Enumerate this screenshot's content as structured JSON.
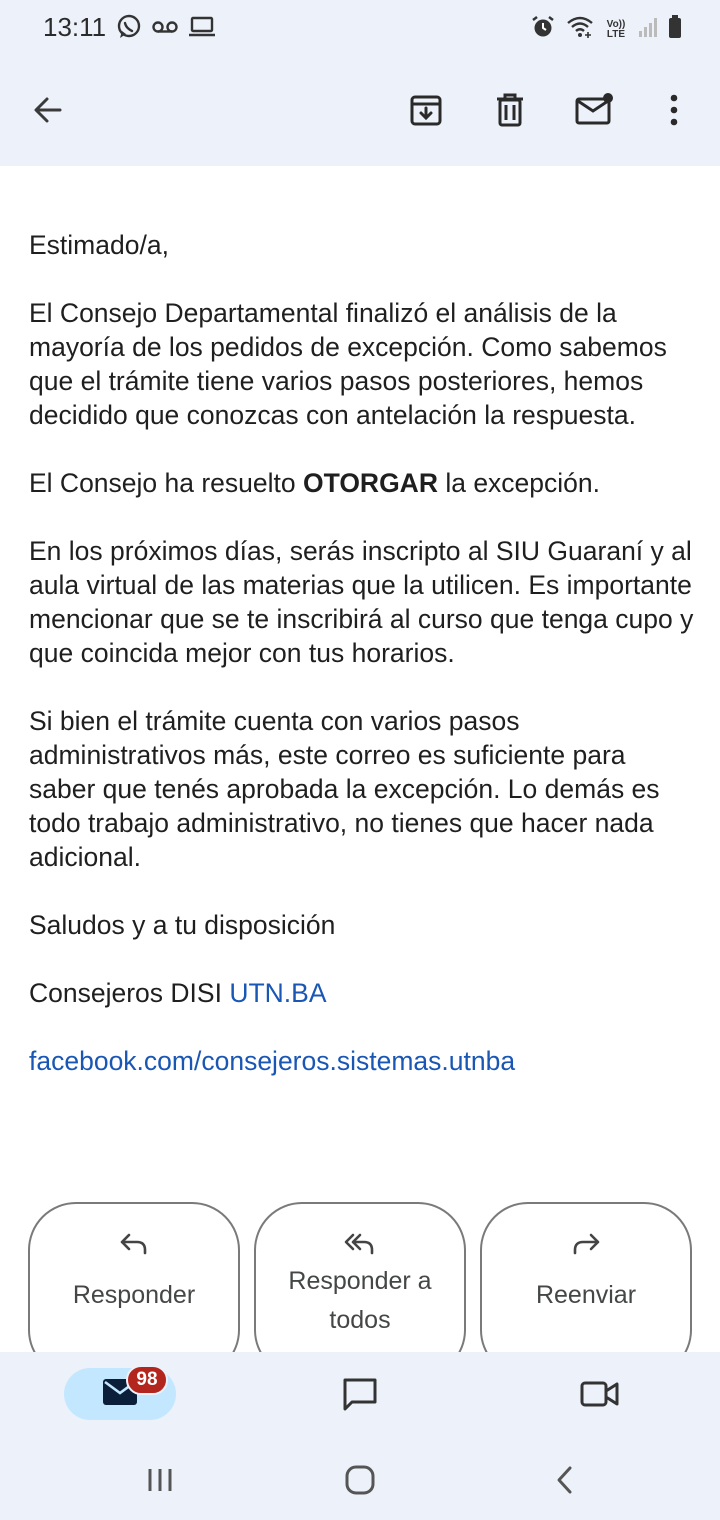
{
  "status_bar": {
    "time": "13:11",
    "left_icons": [
      "whatsapp-icon",
      "voicemail-icon",
      "laptop-icon"
    ],
    "right_icons": [
      "alarm-icon",
      "wifi-icon",
      "volte-icon",
      "signal-icon",
      "battery-icon"
    ],
    "volte_top": "Vo))",
    "volte_bottom": "LTE"
  },
  "toolbar": {
    "icons": [
      "back-arrow-icon",
      "archive-icon",
      "delete-icon",
      "mark-unread-icon",
      "more-vert-icon"
    ]
  },
  "email": {
    "greeting": "Estimado/a,",
    "paragraph1": "El Consejo Departamental finalizó el análisis de la mayoría de los pedidos de excepción. Como sabemos que el trámite tiene varios pasos posteriores, hemos decidido que conozcas con antelación la respuesta.",
    "paragraph2_before": "El Consejo ha resuelto ",
    "paragraph2_bold": "OTORGAR",
    "paragraph2_after": " la excepción.",
    "paragraph3": "En los próximos días, serás inscripto al SIU Guaraní y al aula virtual de las materias que la utilicen. Es importante mencionar que se te inscribirá al curso que tenga cupo y que coincida mejor con tus horarios.",
    "paragraph4": "Si bien el trámite cuenta con varios pasos administrativos más, este correo es suficiente para saber que tenés aprobada la excepción. Lo demás es todo trabajo administrativo, no tienes que hacer nada adicional.",
    "closing": "Saludos y a tu disposición",
    "signature_text": "Consejeros DISI ",
    "signature_link": "UTN.BA",
    "facebook_link": "facebook.com/consejeros.sistemas.utnba"
  },
  "actions": {
    "reply_label": "Responder",
    "reply_all_label": "Responder a todos",
    "forward_label": "Reenviar"
  },
  "bottom_nav": {
    "mail_badge": "98",
    "items": [
      "mail-icon",
      "chat-icon",
      "meet-icon"
    ]
  },
  "system_nav": {
    "items": [
      "recents-icon",
      "home-icon",
      "back-icon"
    ]
  }
}
